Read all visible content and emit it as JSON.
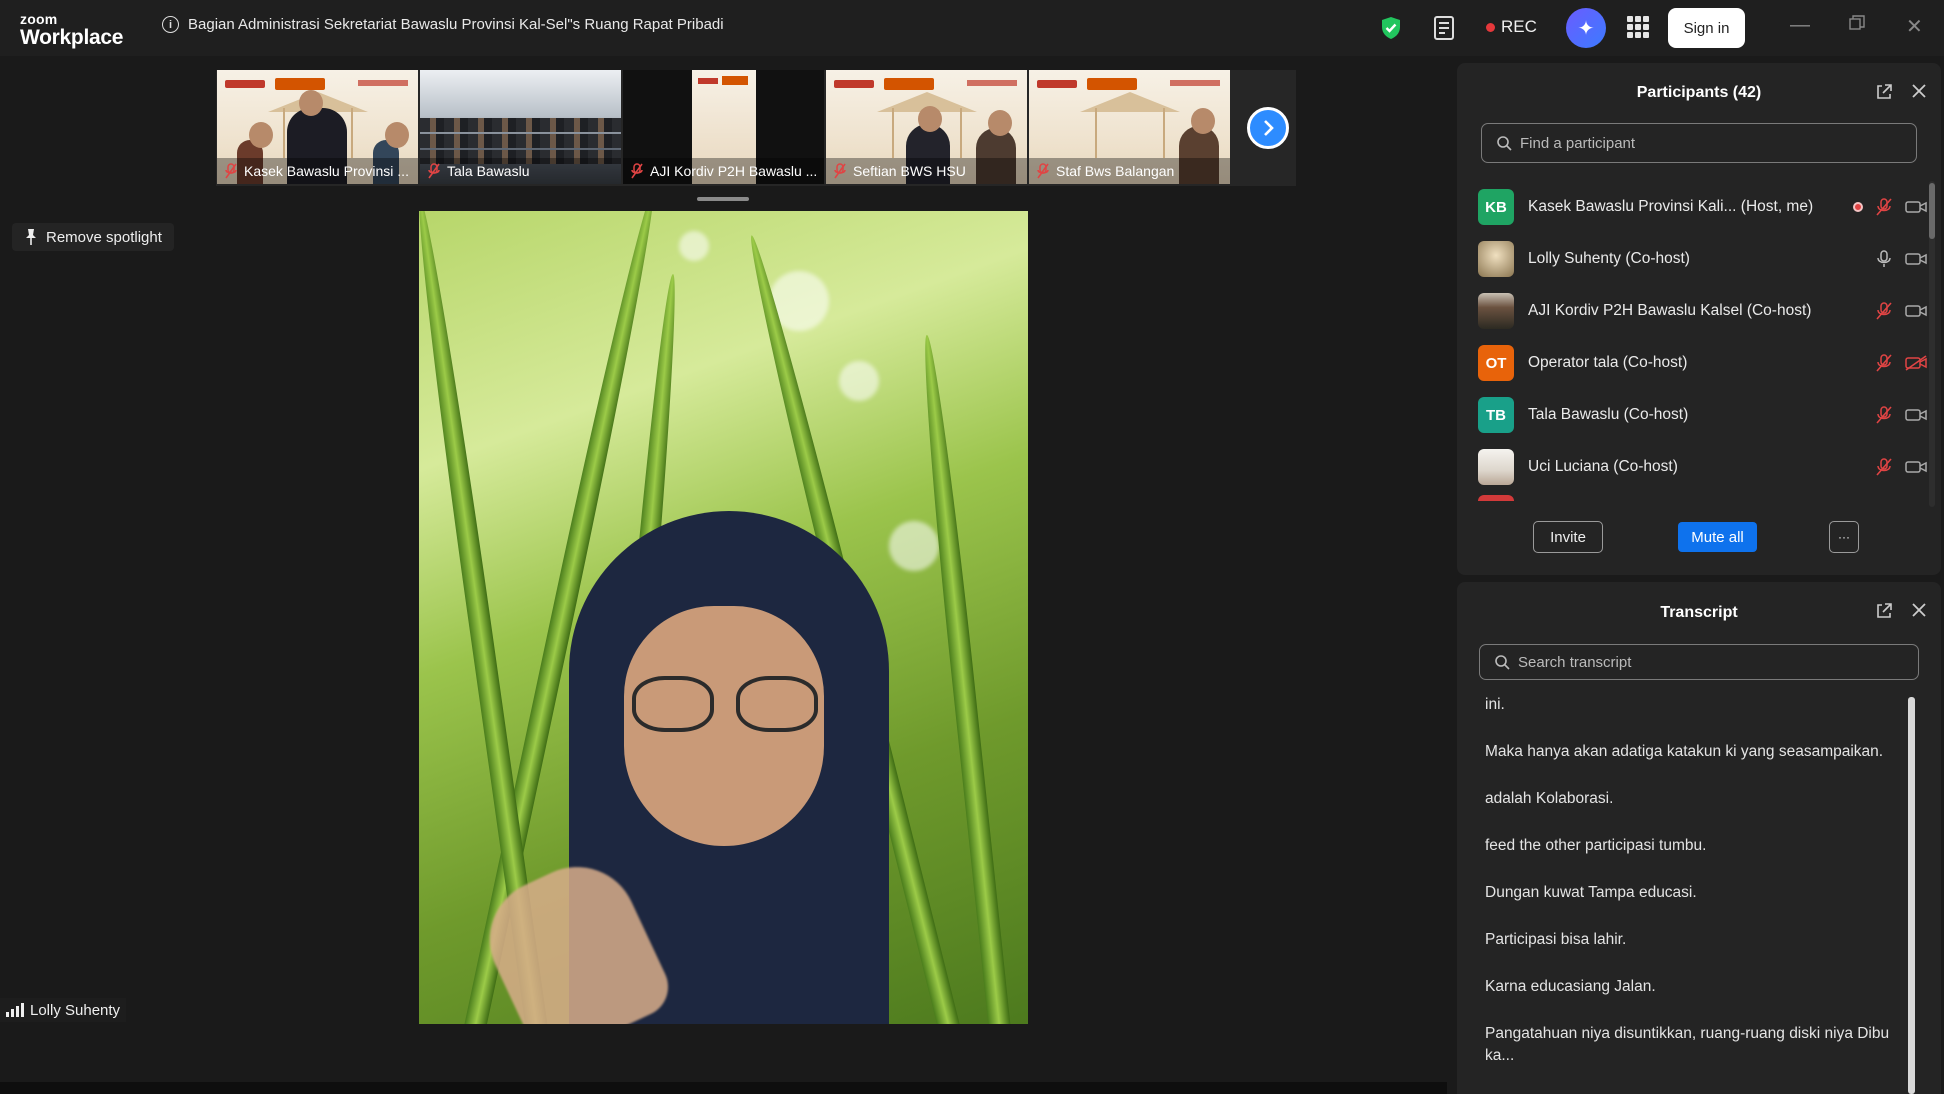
{
  "app": {
    "logo_small": "zoom",
    "logo_large": "Workplace"
  },
  "meeting": {
    "title": "Bagian Administrasi Sekretariat Bawaslu Provinsi Kal-Sel\"s Ruang Rapat Pribadi"
  },
  "toolbar": {
    "rec_label": "REC",
    "signin_label": "Sign in"
  },
  "thumbnails": [
    {
      "name": "Kasek Bawaslu Provinsi ..."
    },
    {
      "name": "Tala Bawaslu"
    },
    {
      "name": "AJI Kordiv P2H Bawaslu ..."
    },
    {
      "name": "Seftian BWS HSU"
    },
    {
      "name": "Staf Bws Balangan"
    }
  ],
  "spotlight": {
    "remove_label": "Remove spotlight"
  },
  "speaker": {
    "name": "Lolly Suhenty"
  },
  "participants": {
    "title": "Participants (42)",
    "search_placeholder": "Find a participant",
    "list": [
      {
        "initials": "KB",
        "name": "Kasek Bawaslu Provinsi Kali...  (Host, me)",
        "avatar_color": "#1fa463"
      },
      {
        "initials": "",
        "name": "Lolly Suhenty (Co-host)",
        "avatar_color": "#b59a70"
      },
      {
        "initials": "",
        "name": "AJI Kordiv P2H Bawaslu Kalsel (Co-host)",
        "avatar_color": "#5a4a3a"
      },
      {
        "initials": "OT",
        "name": "Operator tala (Co-host)",
        "avatar_color": "#e8630a"
      },
      {
        "initials": "TB",
        "name": "Tala Bawaslu (Co-host)",
        "avatar_color": "#19a089"
      },
      {
        "initials": "",
        "name": "Uci Luciana (Co-host)",
        "avatar_color": "#e9e4dc"
      }
    ],
    "invite_label": "Invite",
    "mute_all_label": "Mute all",
    "more_label": "···"
  },
  "transcript": {
    "title": "Transcript",
    "search_placeholder": "Search transcript",
    "lines": [
      "ini.",
      "Maka hanya akan adatiga katakun ki yang seasampaikan.",
      "adalah Kolaborasi.",
      "feed the other participasi tumbu.",
      "Dungan kuwat Tampa educasi.",
      "Participasi bisa lahir.",
      "Karna educasiang Jalan.",
      "Pangatahuan niya disuntikkan, ruang-ruang diski niya Dibu ka..."
    ]
  },
  "colors": {
    "accent": "#0e72ed",
    "rec": "#e5383b",
    "shield": "#22c55e",
    "muted": "#e04444"
  }
}
